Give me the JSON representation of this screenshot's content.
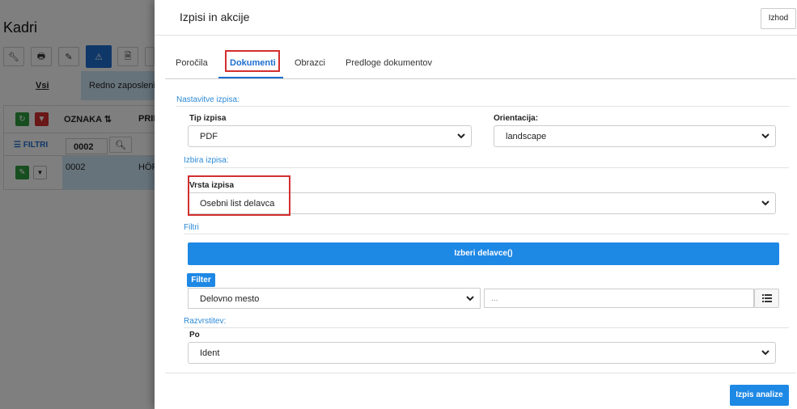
{
  "background": {
    "title": "Kadri",
    "tabs": {
      "all": "Vsi",
      "selected": "Redno zaposleni"
    },
    "grid": {
      "col_code": "OZNAKA",
      "col_name": "PRII",
      "filters_label": "FILTRI",
      "code_filter_value": "0002",
      "rows": [
        {
          "code": "0002",
          "name": "HÖR"
        }
      ]
    }
  },
  "modal": {
    "title": "Izpisi in akcije",
    "close_label": "Izhod",
    "tabs": [
      {
        "label": "Poročila"
      },
      {
        "label": "Dokumenti"
      },
      {
        "label": "Obrazci"
      },
      {
        "label": "Predloge dokumentov"
      }
    ],
    "active_tab_index": 1,
    "settings": {
      "section_label": "Nastavitve izpisa:",
      "type_label": "Tip izpisa",
      "type_value": "PDF",
      "orientation_label": "Orientacija:",
      "orientation_value": "landscape"
    },
    "selection": {
      "section_label": "Izbira izpisa:",
      "kind_label": "Vrsta izpisa",
      "kind_value": "Osebni list delavca"
    },
    "filters": {
      "section_label": "Filtri",
      "choose_button": "Izberi delavce()",
      "filter_badge": "Filter",
      "field_value": "Delovno mesto",
      "value_placeholder": "..."
    },
    "sorting": {
      "section_label": "Razvrstitev:",
      "by_label": "Po",
      "by_value": "Ident"
    },
    "submit_label": "Izpis analize"
  },
  "colors": {
    "accent": "#1e88e5",
    "highlight_box": "#d32f2f",
    "section_text": "#2b8ad8"
  }
}
